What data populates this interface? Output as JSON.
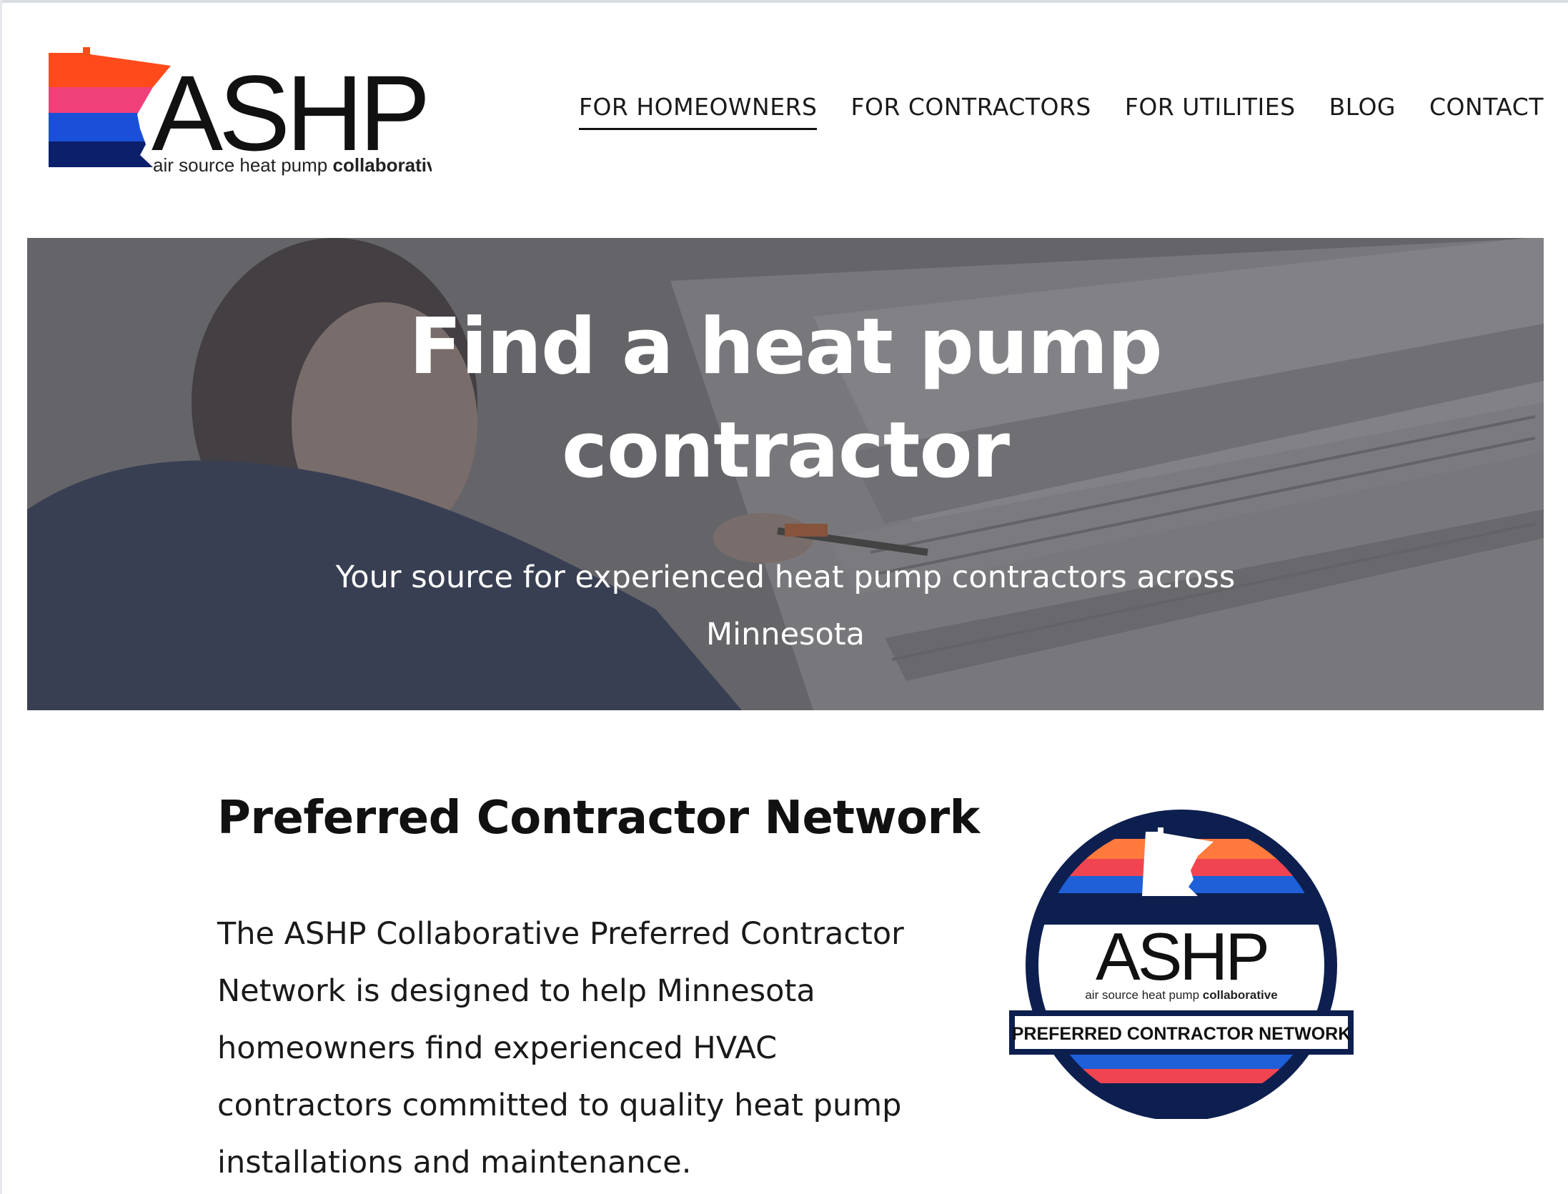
{
  "logo": {
    "wordmark": "ASHP",
    "tagline_light": "air source heat pump",
    "tagline_bold": "collaborative",
    "colors": [
      "#ff4a1c",
      "#f0407a",
      "#1a4fd8",
      "#0b1f6b"
    ]
  },
  "nav": {
    "items": [
      {
        "label": "FOR HOMEOWNERS",
        "active": true
      },
      {
        "label": "FOR CONTRACTORS",
        "active": false
      },
      {
        "label": "FOR UTILITIES",
        "active": false
      },
      {
        "label": "BLOG",
        "active": false
      },
      {
        "label": "CONTACT",
        "active": false
      }
    ]
  },
  "hero": {
    "title_line1": "Find a heat pump",
    "title_line2": "contractor",
    "subtitle_line1": "Your source for experienced heat pump contractors across",
    "subtitle_line2": "Minnesota"
  },
  "section": {
    "title": "Preferred Contractor Network",
    "body_lines": [
      "The ASHP Collaborative Preferred Contractor",
      "Network is designed to help Minnesota",
      "homeowners find experienced HVAC",
      "contractors committed to quality heat pump",
      "installations and maintenance."
    ]
  },
  "badge": {
    "wordmark": "ASHP",
    "tagline_light": "air source heat pump",
    "tagline_bold": "collaborative",
    "banner": "PREFERRED CONTRACTOR NETWORK",
    "colors": {
      "navy": "#0d1f4f",
      "orange": "#ff7a3c",
      "red": "#f04550",
      "blue": "#1f5fd8"
    }
  }
}
